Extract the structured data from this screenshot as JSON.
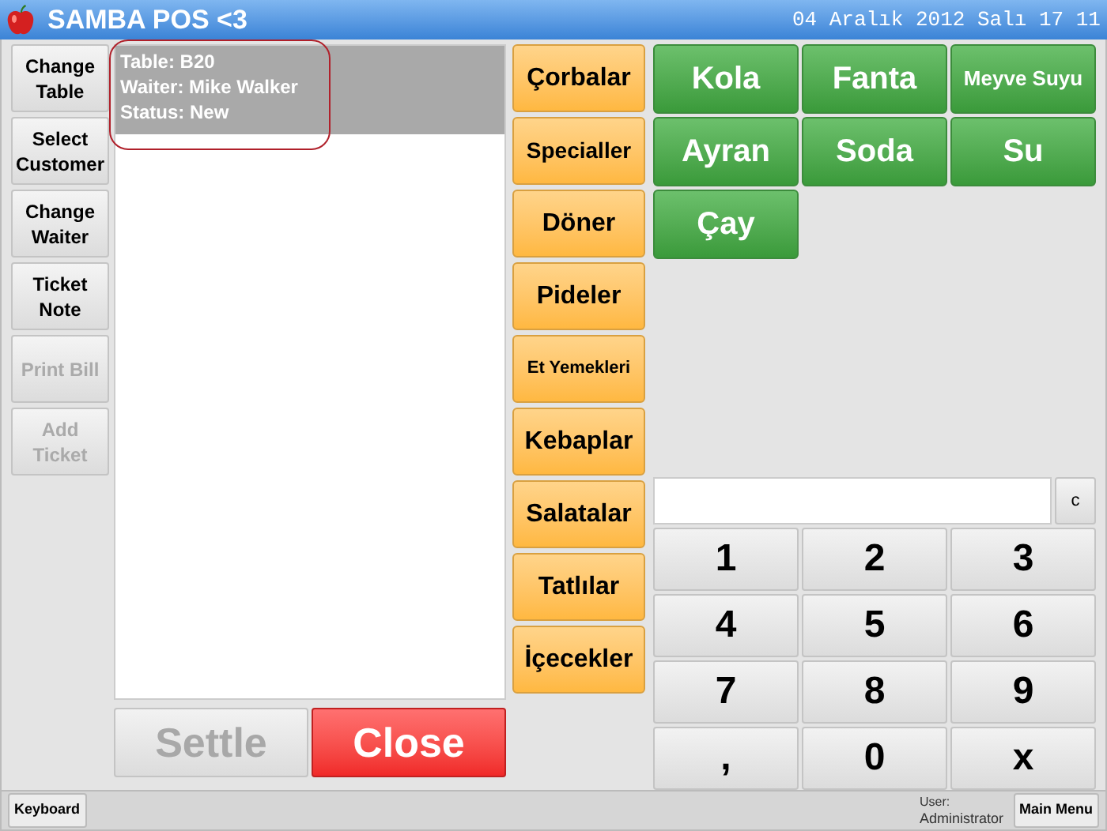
{
  "window": {
    "title": "SAMBA POS <3",
    "datetime": "04 Aralık 2012 Salı 17 11"
  },
  "ticket_actions": [
    {
      "label": "Change Table",
      "disabled": false
    },
    {
      "label": "Select Customer",
      "disabled": false
    },
    {
      "label": "Change Waiter",
      "disabled": false
    },
    {
      "label": "Ticket Note",
      "disabled": false
    },
    {
      "label": "Print Bill",
      "disabled": true
    },
    {
      "label": "Add Ticket",
      "disabled": true
    }
  ],
  "ticket": {
    "lines": [
      "Table: B20",
      "Waiter: Mike Walker",
      "Status: New"
    ],
    "highlighted": true
  },
  "footer_buttons": [
    {
      "label": "Settle",
      "kind": "neutral",
      "disabled": true
    },
    {
      "label": "Close",
      "kind": "danger",
      "disabled": false
    }
  ],
  "categories": [
    "Çorbalar",
    "Specialler",
    "Döner",
    "Pideler",
    "Et Yemekleri",
    "Kebaplar",
    "Salatalar",
    "Tatlılar",
    "İçecekler"
  ],
  "products": [
    "Kola",
    "Fanta",
    "Meyve Suyu",
    "Ayran",
    "Soda",
    "Su",
    "Çay"
  ],
  "numpad": {
    "clear": "c",
    "keys": [
      "1",
      "2",
      "3",
      "4",
      "5",
      "6",
      "7",
      "8",
      "9",
      ",",
      "0",
      "x"
    ]
  },
  "status_bar": {
    "keyboard": "Keyboard",
    "user_label": "User:",
    "user": "Administrator",
    "main_menu": "Main Menu"
  }
}
